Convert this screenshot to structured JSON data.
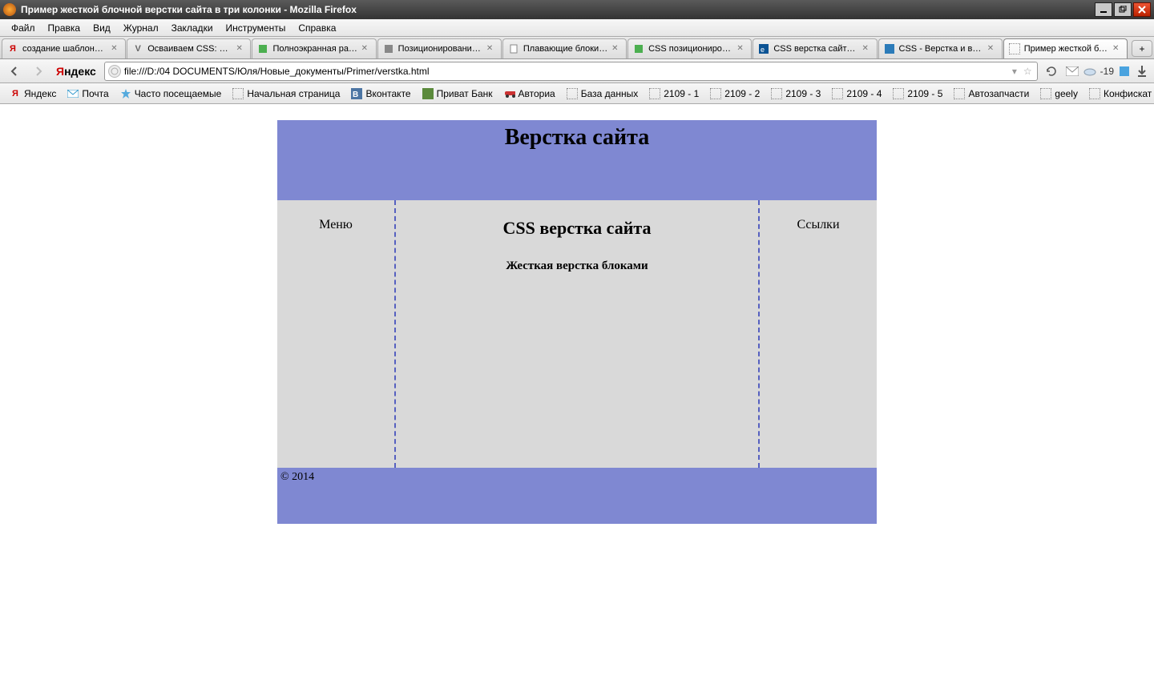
{
  "window": {
    "title": "Пример жесткой блочной верстки сайта в три колонки - Mozilla Firefox"
  },
  "menu": [
    "Файл",
    "Правка",
    "Вид",
    "Журнал",
    "Закладки",
    "Инструменты",
    "Справка"
  ],
  "tabs": [
    {
      "label": "создание шаблона Fr...",
      "icon": "ya",
      "active": false
    },
    {
      "label": "Осваиваем CSS: ма...",
      "icon": "v",
      "active": false
    },
    {
      "label": "Полноэкранная раз...",
      "icon": "puzzle",
      "active": false
    },
    {
      "label": "Позиционирование б...",
      "icon": "sq",
      "active": false
    },
    {
      "label": "Плавающие блоки C...",
      "icon": "doc",
      "active": false
    },
    {
      "label": "CSS позиционирова...",
      "icon": "puzzle",
      "active": false
    },
    {
      "label": "CSS верстка сайта - ...",
      "icon": "ez",
      "active": false
    },
    {
      "label": "CSS - Верстка и выр...",
      "icon": "css",
      "active": false
    },
    {
      "label": "Пример жесткой бло...",
      "icon": "page",
      "active": true
    }
  ],
  "urlbar": {
    "value": "file:///D:/04 DOCUMENTS/Юля/Новые_документы/Primer/verstka.html"
  },
  "weather": {
    "temp": "-19"
  },
  "bookmarks": [
    {
      "label": "Яндекс",
      "icon": "ya"
    },
    {
      "label": "Почта",
      "icon": "mail"
    },
    {
      "label": "Часто посещаемые",
      "icon": "star"
    },
    {
      "label": "Начальная страница",
      "icon": "page"
    },
    {
      "label": "Вконтакте",
      "icon": "vk"
    },
    {
      "label": "Приват Банк",
      "icon": "pb"
    },
    {
      "label": "Авториа",
      "icon": "car"
    },
    {
      "label": "База данных",
      "icon": "page"
    },
    {
      "label": "2109 - 1",
      "icon": "page"
    },
    {
      "label": "2109 - 2",
      "icon": "page"
    },
    {
      "label": "2109 - 3",
      "icon": "page"
    },
    {
      "label": "2109 - 4",
      "icon": "page"
    },
    {
      "label": "2109 - 5",
      "icon": "page"
    },
    {
      "label": "Автозапчасти",
      "icon": "page"
    },
    {
      "label": "geely",
      "icon": "page"
    },
    {
      "label": "Конфискат судебный",
      "icon": "page"
    }
  ],
  "page": {
    "header_title": "Верстка сайта",
    "left_title": "Меню",
    "center_title": "CSS верстка сайта",
    "center_subtitle": "Жесткая верстка блоками",
    "right_title": "Ссылки",
    "footer": "© 2014"
  }
}
